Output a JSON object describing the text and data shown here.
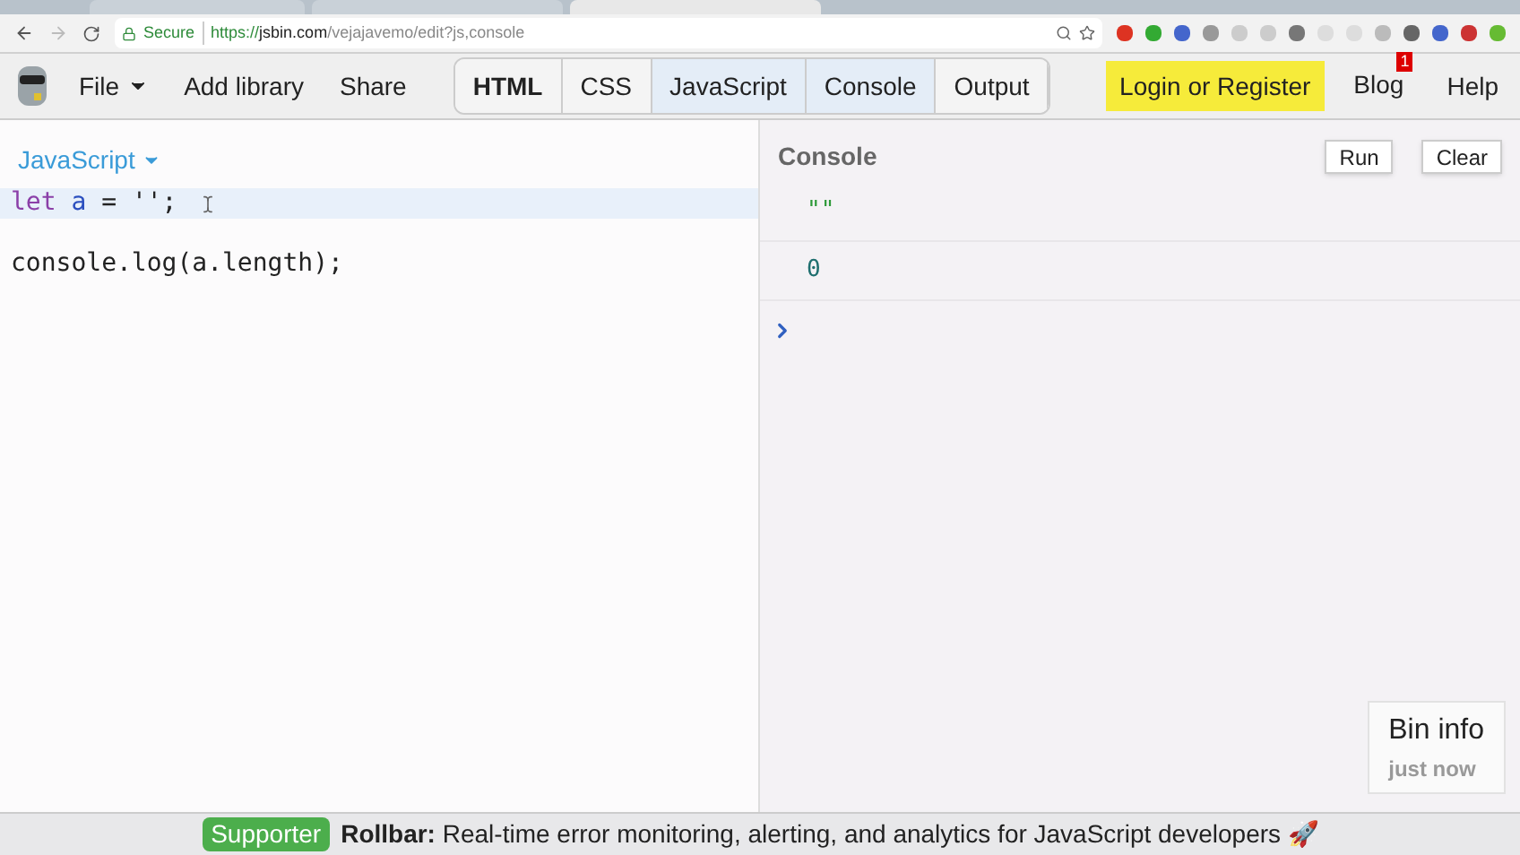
{
  "browser": {
    "secure_label": "Secure",
    "url_scheme": "https://",
    "url_host": "jsbin.com",
    "url_path": "/vejajavemo/edit?js,console"
  },
  "toolbar": {
    "menu": [
      {
        "label": "File",
        "dropdown": true
      },
      {
        "label": "Add library",
        "dropdown": false
      },
      {
        "label": "Share",
        "dropdown": false
      }
    ],
    "panels": [
      {
        "label": "HTML",
        "selected": false,
        "bold": true
      },
      {
        "label": "CSS",
        "selected": false,
        "bold": false
      },
      {
        "label": "JavaScript",
        "selected": true,
        "bold": false
      },
      {
        "label": "Console",
        "selected": true,
        "bold": false
      },
      {
        "label": "Output",
        "selected": false,
        "bold": false
      }
    ],
    "login": "Login or Register",
    "blog": {
      "label": "Blog",
      "badge": "1"
    },
    "help": "Help"
  },
  "editor": {
    "language": "JavaScript",
    "lines": [
      {
        "active": true,
        "cursor": true,
        "tokens": [
          {
            "text": "let",
            "kind": "keyword"
          },
          {
            "text": " a",
            "kind": "variable"
          },
          {
            "text": " = '",
            "kind": "plain"
          },
          {
            "text": "';",
            "kind": "plain"
          }
        ]
      },
      {
        "active": false,
        "cursor": false
      },
      {
        "active": false,
        "cursor": false,
        "tokens": [
          {
            "text": "console.log(a.length);",
            "kind": "plain"
          }
        ]
      }
    ]
  },
  "console": {
    "title": "Console",
    "buttons": [
      "Run",
      "Clear"
    ],
    "entries": [
      {
        "text": "\"\"",
        "kind": "string"
      },
      {
        "text": "0",
        "kind": "number"
      }
    ]
  },
  "bin_info": {
    "title": "Bin info",
    "time": "just now"
  },
  "footer": {
    "badge": "Supporter",
    "sponsor": "Rollbar:",
    "message": "Real-time error monitoring, alerting, and analytics for JavaScript developers 🚀"
  }
}
